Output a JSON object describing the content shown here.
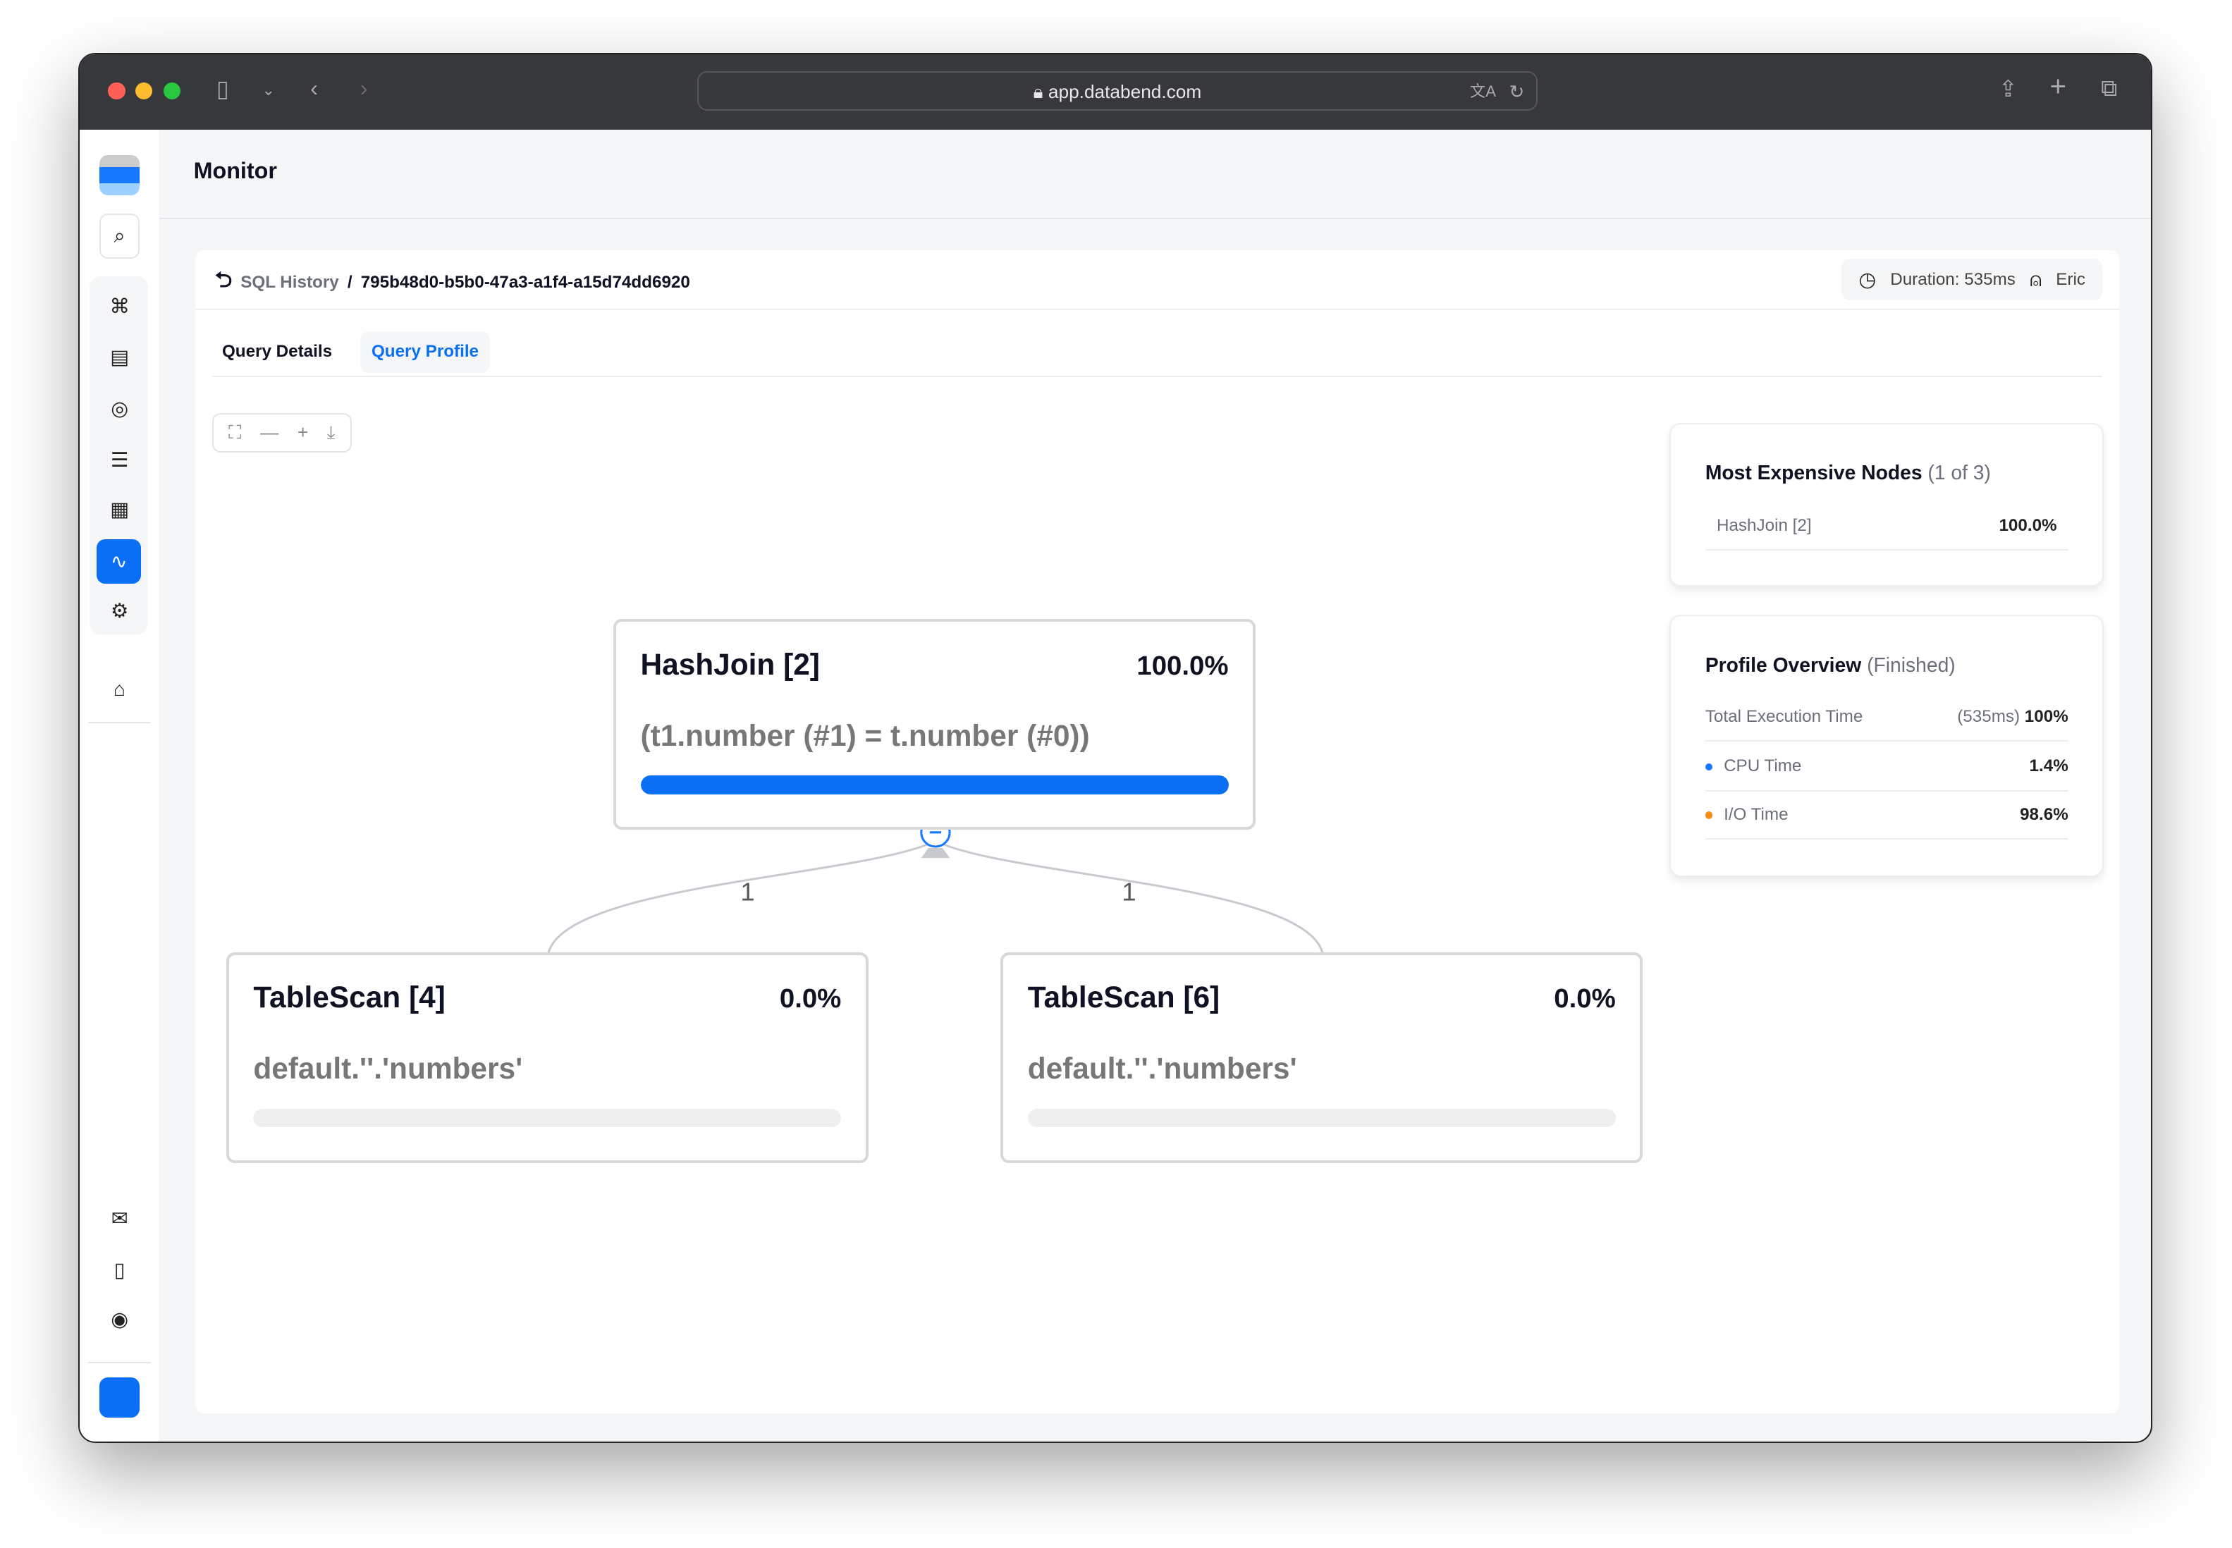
{
  "browser": {
    "url": "app.databend.com"
  },
  "page": {
    "title": "Monitor"
  },
  "breadcrumb": {
    "parent": "SQL History",
    "separator": "/",
    "current": "795b48d0-b5b0-47a3-a1f4-a15d74dd6920"
  },
  "meta": {
    "duration": "Duration: 535ms",
    "user": "Eric"
  },
  "tabs": [
    {
      "label": "Query Details"
    },
    {
      "label": "Query Profile",
      "active": true
    }
  ],
  "graph": {
    "nodes": [
      {
        "title": "HashJoin [2]",
        "percent": "100.0%",
        "desc": "(t1.number (#1) = t.number (#0))",
        "progress": 100
      },
      {
        "title": "TableScan [4]",
        "percent": "0.0%",
        "desc": "default.''.'numbers'",
        "progress": 0
      },
      {
        "title": "TableScan [6]",
        "percent": "0.0%",
        "desc": "default.''.'numbers'",
        "progress": 0
      }
    ],
    "edges": [
      {
        "label": "1"
      },
      {
        "label": "1"
      }
    ]
  },
  "expensive": {
    "title": "Most Expensive Nodes",
    "count": "(1 of 3)",
    "items": [
      {
        "name": "HashJoin [2]",
        "value": "100.0%"
      }
    ]
  },
  "overview": {
    "title": "Profile Overview",
    "status": "(Finished)",
    "total": {
      "label": "Total Execution Time",
      "ms": "(535ms)",
      "pct": "100%"
    },
    "cpu": {
      "label": "CPU Time",
      "value": "1.4%",
      "color": "#1677ff"
    },
    "io": {
      "label": "I/O Time",
      "value": "98.6%",
      "color": "#fa8c16"
    }
  },
  "colors": {
    "accent": "#0b6ff5"
  }
}
